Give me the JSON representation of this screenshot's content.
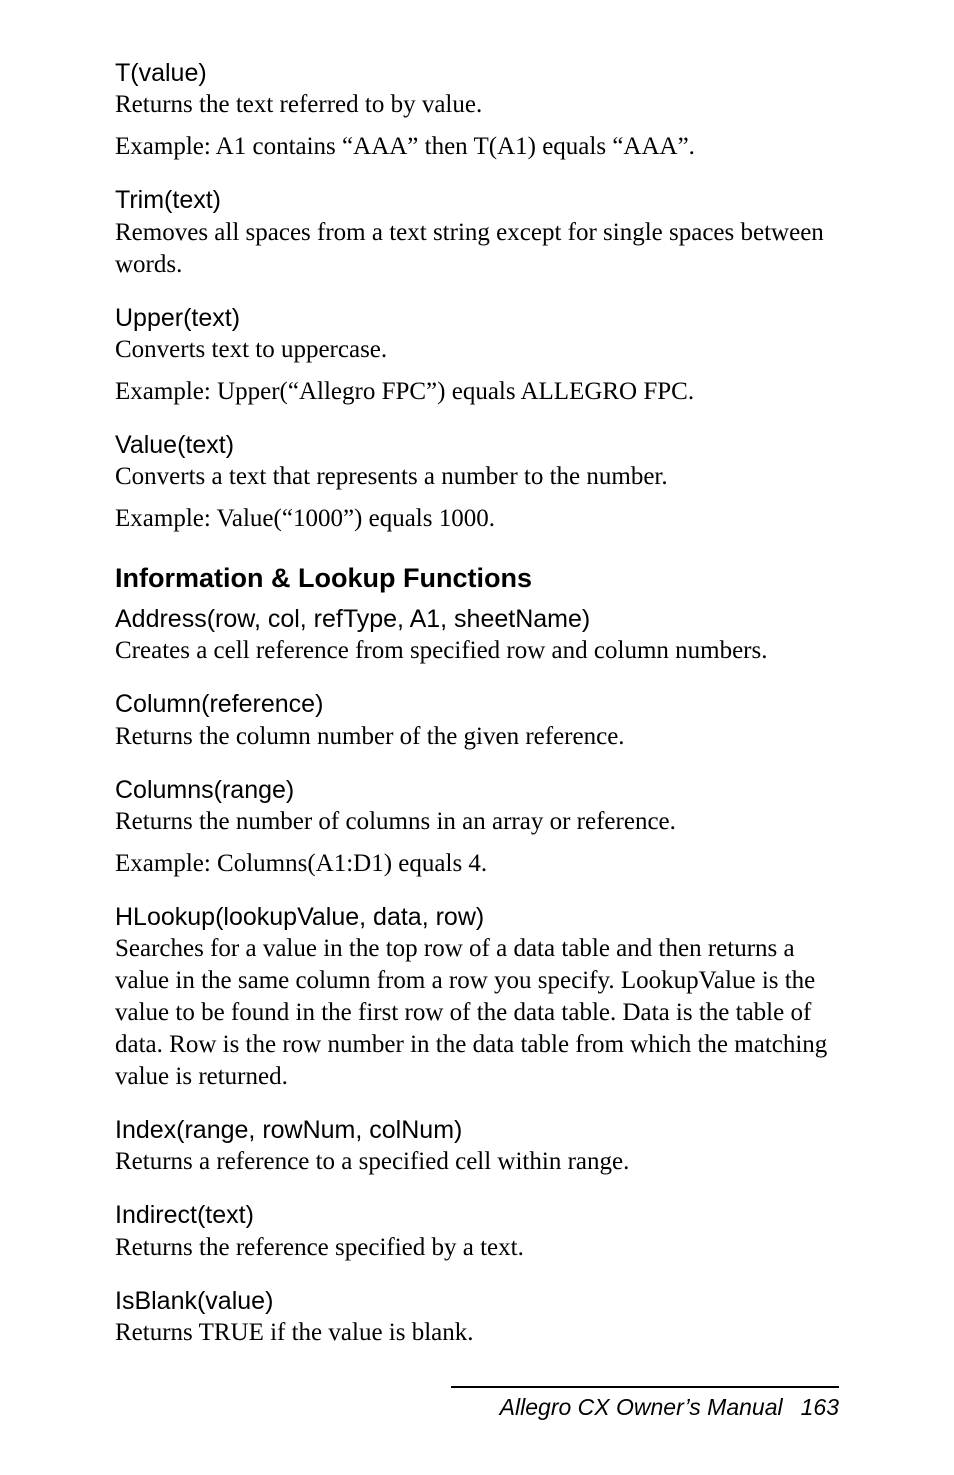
{
  "functions": [
    {
      "name": "T(value)",
      "desc": "Returns the text referred to by value.",
      "example": "Example: A1 contains “AAA” then T(A1) equals “AAA”."
    },
    {
      "name": "Trim(text)",
      "desc": "Removes all spaces from a text string except for single spaces between words."
    },
    {
      "name": "Upper(text)",
      "desc": "Converts text to uppercase.",
      "example": "Example: Upper(“Allegro FPC”) equals ALLEGRO FPC."
    },
    {
      "name": "Value(text)",
      "desc": "Converts a text that represents a number to the number.",
      "example": "Example: Value(“1000”) equals 1000."
    }
  ],
  "section_title": "Information & Lookup Functions",
  "functions2": [
    {
      "name": "Address(row, col, refType, A1, sheetName)",
      "desc": "Creates a cell reference from specified row and column numbers."
    },
    {
      "name": "Column(reference)",
      "desc": "Returns the column number of the given reference."
    },
    {
      "name": "Columns(range)",
      "desc": "Returns the number of columns in an array or reference.",
      "example": "Example: Columns(A1:D1) equals 4."
    },
    {
      "name": "HLookup(lookupValue, data, row)",
      "desc": "Searches for a value in the top row of a data table and then returns a value in the same column from a row you specify. LookupValue is the value to be found in the first row of the data table. Data is the table of data. Row is the row number in the data table from which the matching value is returned."
    },
    {
      "name": "Index(range, rowNum, colNum)",
      "desc": "Returns a reference to a specified cell within range."
    },
    {
      "name": "Indirect(text)",
      "desc": "Returns the reference specified by a text."
    },
    {
      "name": "IsBlank(value)",
      "desc": "Returns TRUE if the value is blank."
    }
  ],
  "footer": {
    "title": "Allegro CX Owner’s Manual",
    "page": "163"
  }
}
